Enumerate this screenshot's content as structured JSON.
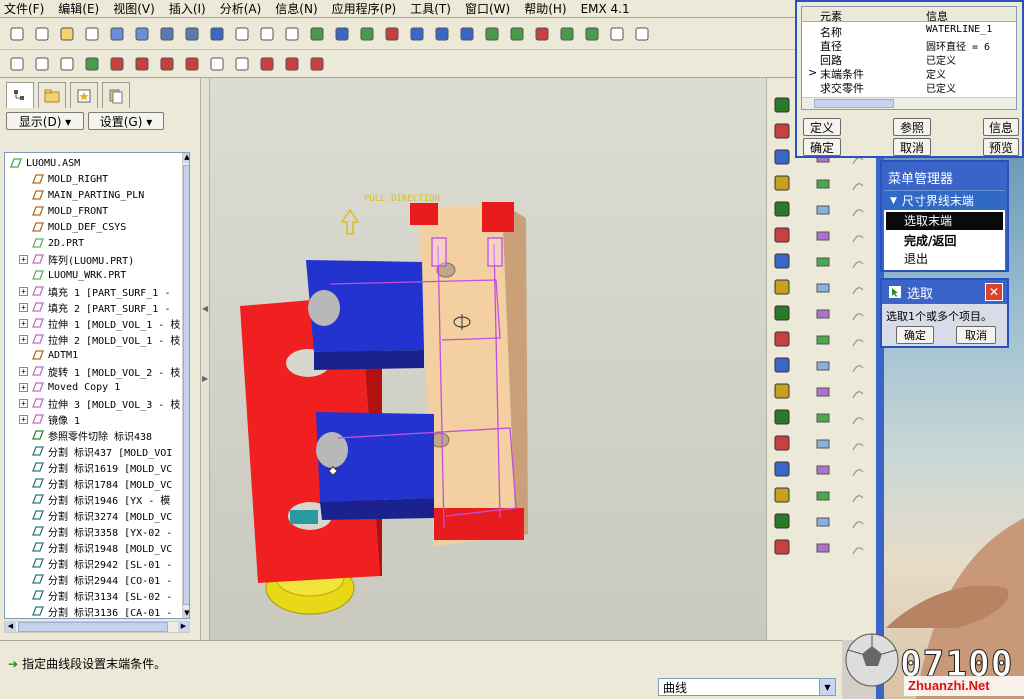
{
  "menu": [
    "文件(F)",
    "编辑(E)",
    "视图(V)",
    "插入(I)",
    "分析(A)",
    "信息(N)",
    "应用程序(P)",
    "工具(T)",
    "窗口(W)",
    "帮助(H)",
    "EMX 4.1"
  ],
  "left_panel": {
    "display_button": "显示(D) ▾",
    "settings_button": "设置(G) ▾",
    "tree": [
      {
        "label": "LUOMU.ASM",
        "icon": "assembly-icon",
        "expand": ""
      },
      {
        "label": "MOLD_RIGHT",
        "icon": "datum-plane-icon",
        "expand": ""
      },
      {
        "label": "MAIN_PARTING_PLN",
        "icon": "datum-plane-icon",
        "expand": ""
      },
      {
        "label": "MOLD_FRONT",
        "icon": "datum-plane-icon",
        "expand": ""
      },
      {
        "label": "MOLD_DEF_CSYS",
        "icon": "csys-icon",
        "expand": ""
      },
      {
        "label": "2D.PRT",
        "icon": "part-icon",
        "expand": ""
      },
      {
        "label": "阵列(LUOMU.PRT)",
        "icon": "pattern-icon",
        "expand": "+"
      },
      {
        "label": "LUOMU_WRK.PRT",
        "icon": "part-icon",
        "expand": ""
      },
      {
        "label": "填充 1 [PART_SURF_1 -",
        "icon": "fill-icon",
        "expand": "+"
      },
      {
        "label": "填充 2 [PART_SURF_1 -",
        "icon": "fill-icon",
        "expand": "+"
      },
      {
        "label": "拉伸 1 [MOLD_VOL_1 - 枝",
        "icon": "extrude-icon",
        "expand": "+"
      },
      {
        "label": "拉伸 2 [MOLD_VOL_1 - 枝",
        "icon": "extrude-icon",
        "expand": "+"
      },
      {
        "label": "ADTM1",
        "icon": "datum-plane-icon",
        "expand": ""
      },
      {
        "label": "旋转 1 [MOLD_VOL_2 - 枝",
        "icon": "revolve-icon",
        "expand": "+"
      },
      {
        "label": "Moved Copy 1",
        "icon": "copy-icon",
        "expand": "+"
      },
      {
        "label": "拉伸 3 [MOLD_VOL_3 - 枝",
        "icon": "extrude-icon",
        "expand": "+"
      },
      {
        "label": "镜像 1",
        "icon": "mirror-icon",
        "expand": "+"
      },
      {
        "label": "参照零件切除 标识438",
        "icon": "cut-icon",
        "expand": ""
      },
      {
        "label": "分割 标识437 [MOLD_VOI",
        "icon": "split-icon",
        "expand": ""
      },
      {
        "label": "分割 标识1619 [MOLD_VC",
        "icon": "split-icon",
        "expand": ""
      },
      {
        "label": "分割 标识1784 [MOLD_VC",
        "icon": "split-icon",
        "expand": ""
      },
      {
        "label": "分割 标识1946 [YX - 模",
        "icon": "split-icon",
        "expand": ""
      },
      {
        "label": "分割 标识3274 [MOLD_VC",
        "icon": "split-icon",
        "expand": ""
      },
      {
        "label": "分割 标识3358 [YX-02 -",
        "icon": "split-icon",
        "expand": ""
      },
      {
        "label": "分割 标识1948 [MOLD_VC",
        "icon": "split-icon",
        "expand": ""
      },
      {
        "label": "分割 标识2942 [SL-01 -",
        "icon": "split-icon",
        "expand": ""
      },
      {
        "label": "分割 标识2944 [CO-01 -",
        "icon": "split-icon",
        "expand": ""
      },
      {
        "label": "分割 标识3134 [SL-02 -",
        "icon": "split-icon",
        "expand": ""
      },
      {
        "label": "分割 标识3136 [CA-01 -",
        "icon": "split-icon",
        "expand": ""
      }
    ]
  },
  "viewport": {
    "pull_direction_label": "PULL DIRECTION"
  },
  "status": {
    "message": "指定曲线段设置末端条件。",
    "filter_value": "曲线"
  },
  "element_info": {
    "col_element": "元素",
    "col_info": "信息",
    "rows": [
      {
        "marker": "",
        "element": "名称",
        "info": "WATERLINE_1"
      },
      {
        "marker": "",
        "element": "直径",
        "info": "圆环直径 = 6"
      },
      {
        "marker": "",
        "element": "回路",
        "info": "已定义"
      },
      {
        "marker": ">",
        "element": "末端条件",
        "info": "定义"
      },
      {
        "marker": "",
        "element": "求交零件",
        "info": "已定义"
      }
    ],
    "btn_define": "定义",
    "btn_refs": "参照",
    "btn_info": "信息",
    "btn_ok": "确定",
    "btn_cancel": "取消",
    "btn_preview": "预览"
  },
  "menu_manager": {
    "title": "菜单管理器",
    "section": "尺寸界线末端",
    "items": [
      "选取末端",
      "完成/返回",
      "退出"
    ]
  },
  "select_dialog": {
    "title": "选取",
    "message": "选取1个或多个项目。",
    "ok": "确定",
    "cancel": "取消"
  },
  "watermark": {
    "number": "07100",
    "site": "Zhuanzhi.Net"
  },
  "colors": {
    "accent_blue": "#2a52be",
    "mold_red": "#e81c1c",
    "mold_blue": "#1e2fc8",
    "mold_tan": "#f3cfa1"
  }
}
